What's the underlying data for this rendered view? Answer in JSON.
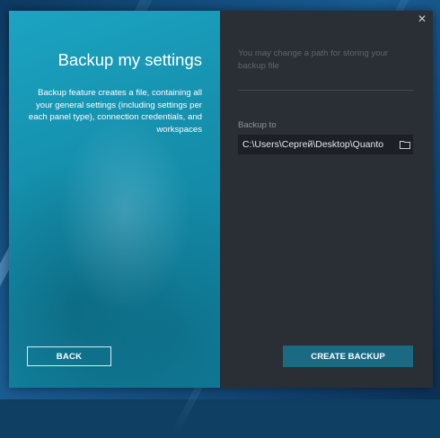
{
  "dialog": {
    "left_panel": {
      "title": "Backup my settings",
      "description": "Backup feature creates a file, containing all your general settings (including settings per each panel type), connection credentials, and workspaces",
      "back_label": "BACK"
    },
    "right_panel": {
      "hint": "You may change a path for storing your backup file",
      "path_label": "Backup to",
      "path_value": "C:\\Users\\Сергей\\Desktop\\Quanto",
      "folder_icon": "folder-icon",
      "create_label": "CREATE BACKUP",
      "close_icon": "close-icon"
    }
  },
  "colors": {
    "left_panel_bg": "#1a9bb8",
    "right_panel_bg": "#2a2e35",
    "primary_button": "#1a6a84",
    "input_bg": "#1c1f24"
  }
}
